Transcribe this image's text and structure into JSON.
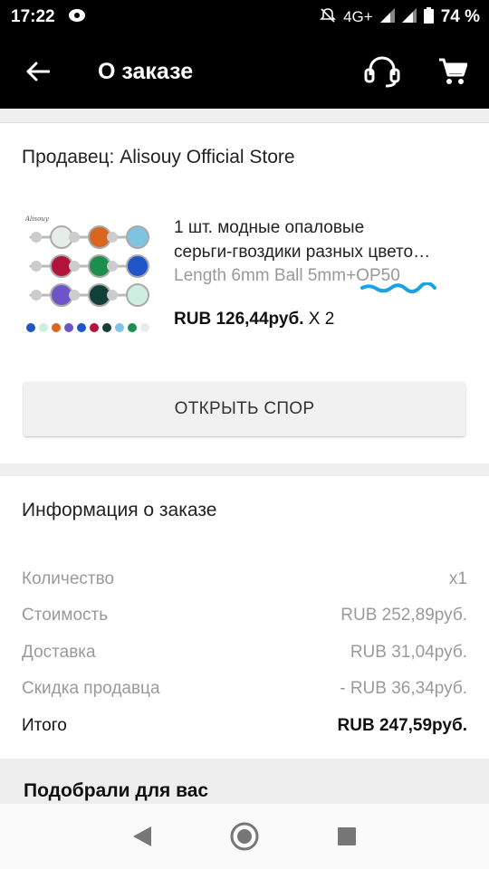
{
  "status": {
    "time": "17:22",
    "network": "4G+",
    "battery": "74 %"
  },
  "header": {
    "title": "О заказе"
  },
  "order": {
    "seller": "Продавец: Alisouy Official Store",
    "product": {
      "title_line1": "1 шт. модные опаловые",
      "title_line2": "серьги-гвоздики разных цвето…",
      "variant": "Length 6mm Ball 5mm+OP50",
      "price": "RUB 126,44руб.",
      "qty": " X 2"
    },
    "dispute_label": "ОТКРЫТЬ СПОР"
  },
  "info": {
    "title": "Информация о заказе",
    "rows": [
      {
        "label": "Количество",
        "value": "x1"
      },
      {
        "label": "Стоимость",
        "value": "RUB 252,89руб."
      },
      {
        "label": "Доставка",
        "value": "RUB 31,04руб."
      },
      {
        "label": "Скидка продавца",
        "value": "- RUB 36,34руб."
      }
    ],
    "total": {
      "label": "Итого",
      "value": "RUB 247,59руб."
    }
  },
  "recommend": {
    "title": "Подобрали для вас"
  },
  "icons": {
    "back": "arrow-left-icon",
    "support": "headset-icon",
    "cart": "cart-icon"
  }
}
